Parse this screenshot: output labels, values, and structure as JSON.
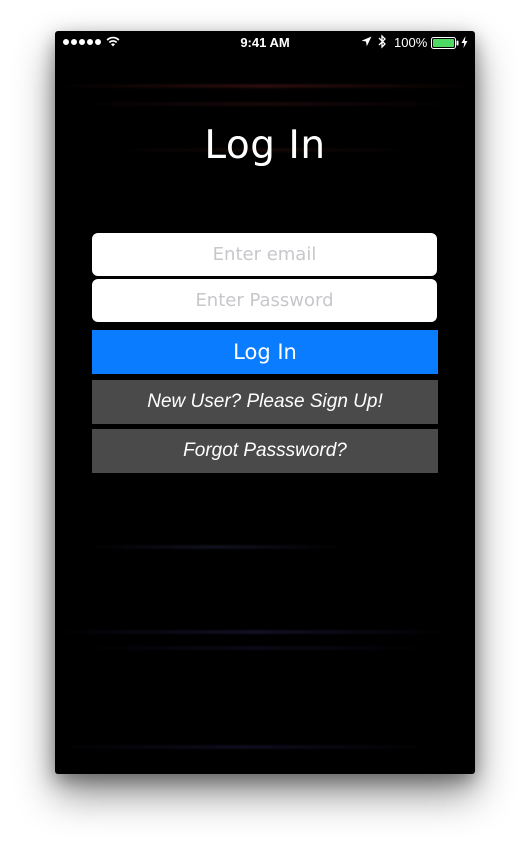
{
  "status_bar": {
    "time": "9:41 AM",
    "battery_percent": "100%",
    "icons": [
      "signal-dots-icon",
      "wifi-icon",
      "location-arrow-icon",
      "bluetooth-icon",
      "battery-icon",
      "charging-bolt-icon"
    ]
  },
  "screen": {
    "title": "Log In"
  },
  "form": {
    "email_placeholder": "Enter email",
    "email_value": "",
    "password_placeholder": "Enter Password",
    "password_value": ""
  },
  "buttons": {
    "login_label": "Log In",
    "signup_label": "New User? Please Sign Up!",
    "forgot_label": "Forgot Passsword?"
  },
  "colors": {
    "background": "#000000",
    "primary_button": "#0a7cff",
    "secondary_button": "#4a4a4a",
    "battery_fill": "#4cd964"
  }
}
